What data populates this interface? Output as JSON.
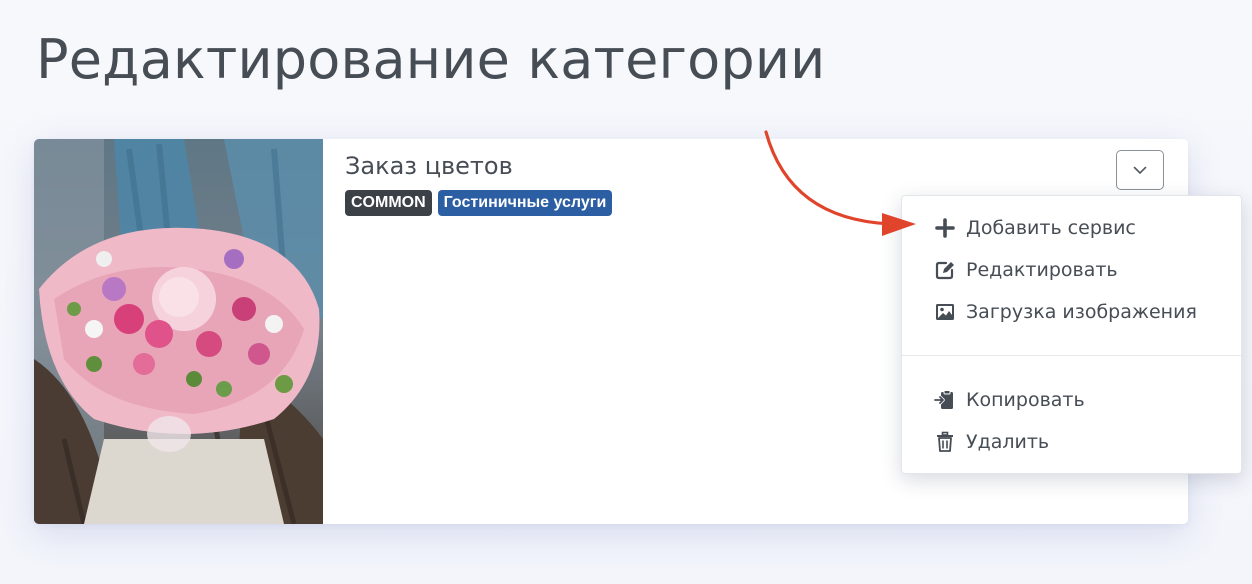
{
  "page": {
    "title": "Редактирование категории"
  },
  "category": {
    "name": "Заказ цветов",
    "badges": [
      "COMMON",
      "Гостиничные услуги"
    ],
    "image": "bouquet-of-pink-flowers-photo"
  },
  "dropdown": {
    "toggle_icon": "chevron-down-icon",
    "items": [
      {
        "label": "Добавить сервис",
        "icon": "plus-icon"
      },
      {
        "label": "Редактировать",
        "icon": "edit-icon"
      },
      {
        "label": "Загрузка изображения",
        "icon": "image-icon"
      },
      {
        "label": "Копировать",
        "icon": "copy-icon"
      },
      {
        "label": "Удалить",
        "icon": "trash-icon"
      }
    ]
  },
  "colors": {
    "badge_common": "#3c4148",
    "badge_service": "#2c5ea3",
    "annotation_arrow": "#e0452b",
    "text": "#474d55"
  }
}
